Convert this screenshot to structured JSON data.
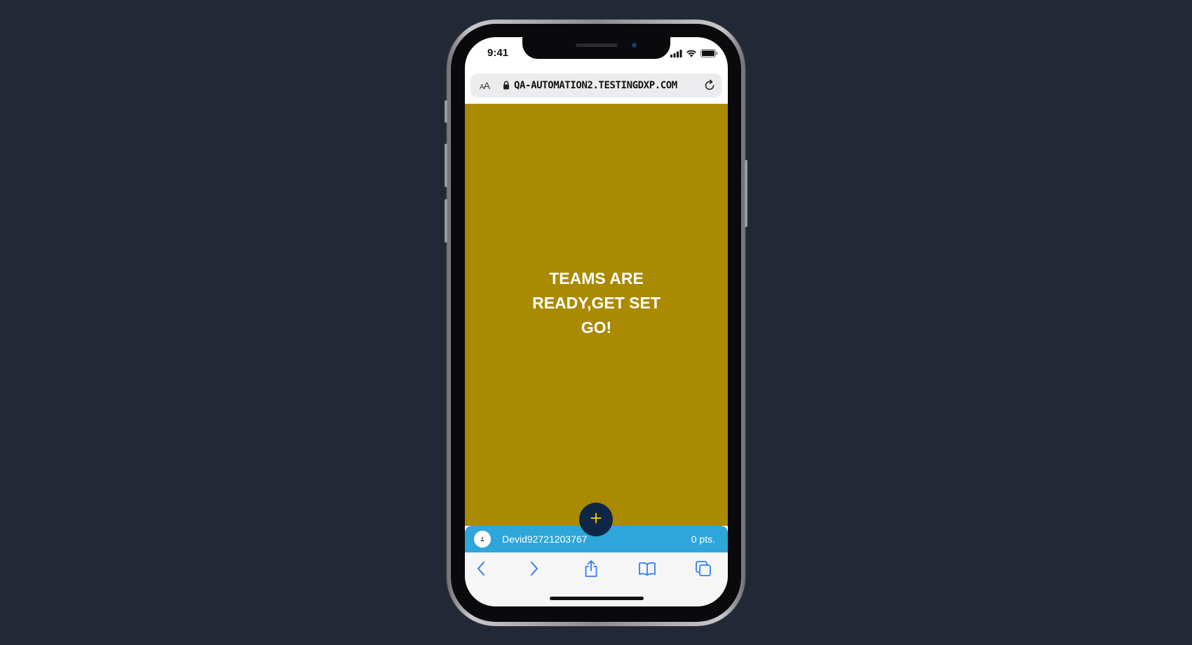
{
  "status_bar": {
    "time": "9:41",
    "icons": [
      "cellular-signal-icon",
      "wifi-icon",
      "battery-icon"
    ]
  },
  "browser": {
    "text_size_label_small": "A",
    "text_size_label_large": "A",
    "url": "QA-AUTOMATION2.TESTINGDXP.COM",
    "icons": [
      "lock-icon",
      "reload-icon"
    ]
  },
  "main": {
    "headline_line1": "TEAMS ARE",
    "headline_line2": "READY,GET SET",
    "headline_line3": "GO!",
    "background_color": "#aa8a00"
  },
  "fab": {
    "icon": "plus-icon",
    "icon_color": "#f2c200",
    "background_color": "#0f2744"
  },
  "player_bar": {
    "username": "Devid92721203767",
    "points": "0 pts.",
    "background_color": "#2ea6da"
  },
  "toolbar": {
    "icons": [
      "back-icon",
      "forward-icon",
      "share-icon",
      "bookmarks-icon",
      "tabs-icon"
    ],
    "accent_color": "#2f7ff0"
  }
}
